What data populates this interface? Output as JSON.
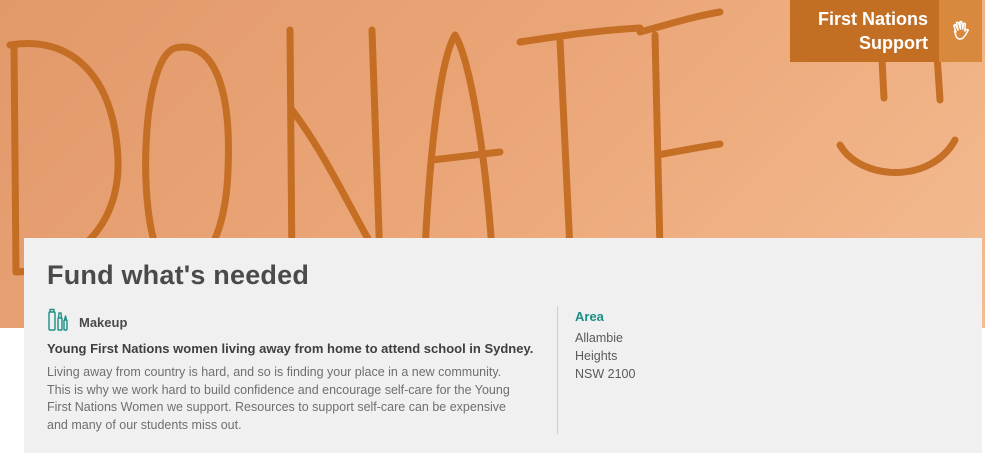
{
  "hero": {
    "handwritten_text": "DONATE",
    "smiley": "smiley-face",
    "background_color": "#eaa577",
    "ink_color": "#c26a1e"
  },
  "badge": {
    "line1": "First Nations",
    "line2": "Support",
    "icon": "hand-wave-icon",
    "background_color": "#c26f24",
    "icon_background_color": "#d9893d"
  },
  "card": {
    "title": "Fund what's needed",
    "category": {
      "icon": "makeup-brush-icon",
      "label": "Makeup"
    },
    "subtitle": "Young First Nations women living away from home to attend school in Sydney.",
    "description": "Living away from country is hard, and so is finding your place in a new community. This is why we work hard to build confidence and encourage self-care for the Young First Nations Women we support. Resources to support self-care can be expensive and many of our students miss out.",
    "area": {
      "heading": "Area",
      "lines": [
        "Allambie",
        "Heights",
        "NSW 2100"
      ]
    },
    "accent_color": "#1d8f86"
  }
}
